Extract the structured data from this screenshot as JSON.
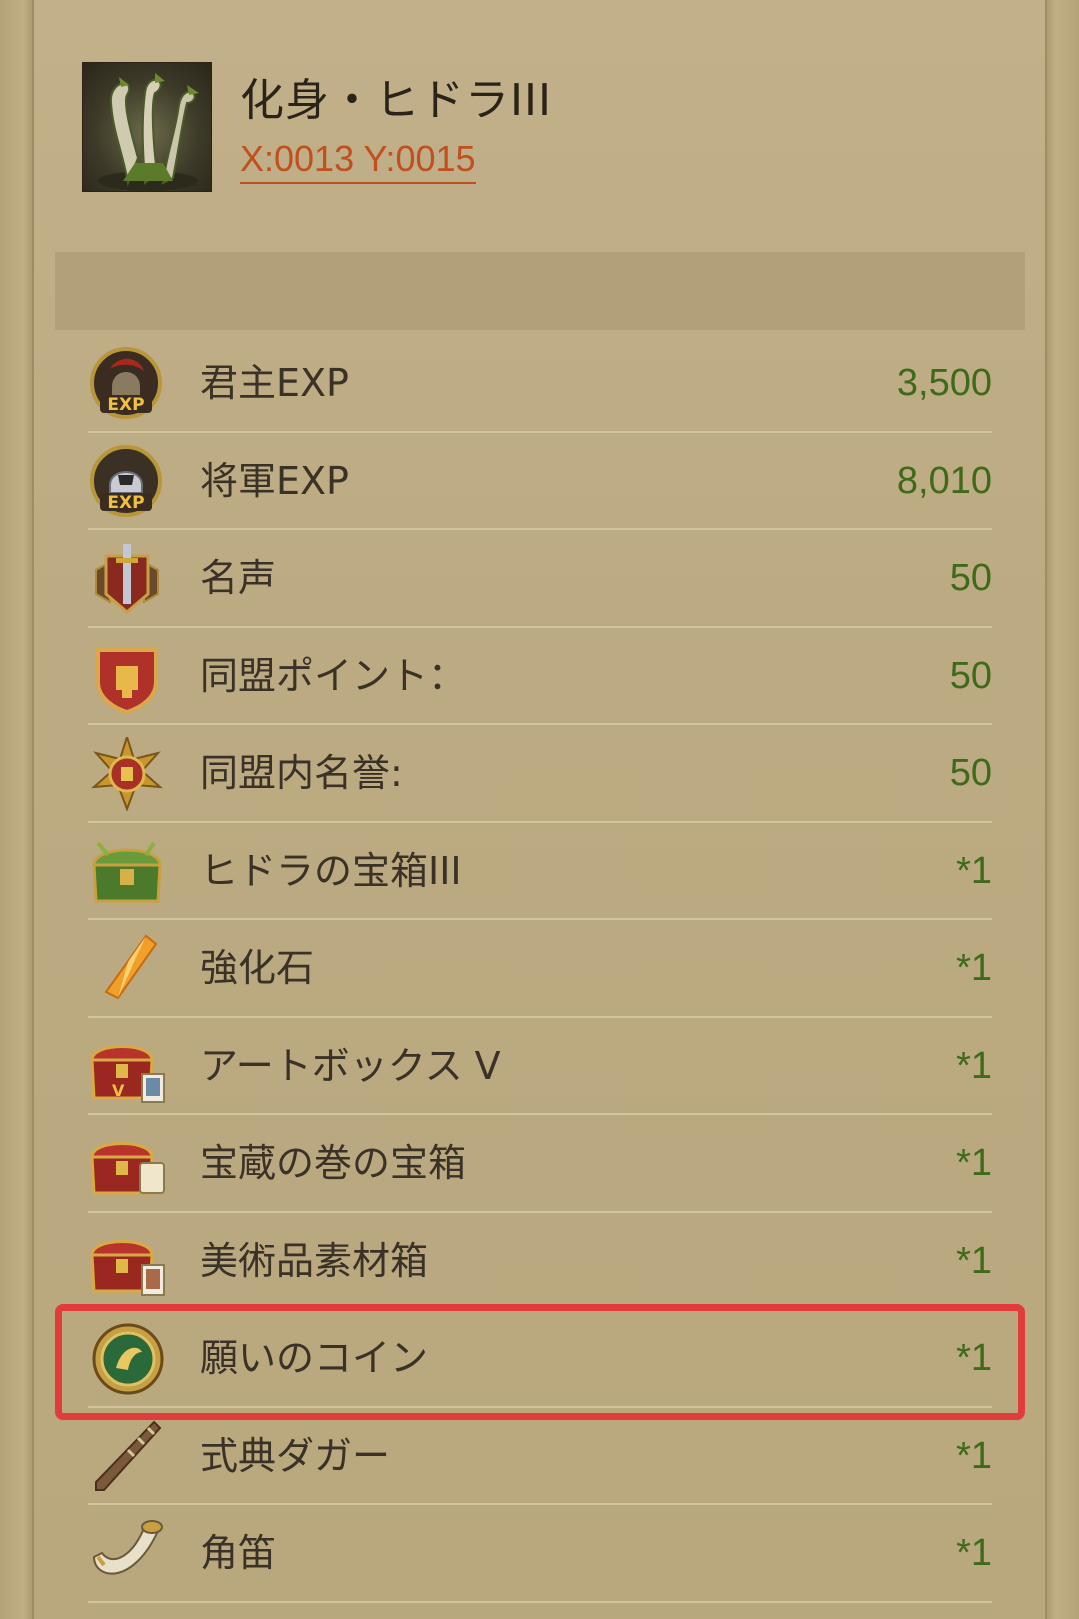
{
  "header": {
    "title": "化身・ヒドラIII",
    "coordinates": "X:0013 Y:0015"
  },
  "rewards": [
    {
      "label": "君主EXP",
      "value": "3,500",
      "icon": "lord-exp-icon"
    },
    {
      "label": "将軍EXP",
      "value": "8,010",
      "icon": "general-exp-icon"
    },
    {
      "label": "名声",
      "value": "50",
      "icon": "fame-icon"
    },
    {
      "label": "同盟ポイント：",
      "value": "50",
      "icon": "alliance-points-icon"
    },
    {
      "label": "同盟内名誉:",
      "value": "50",
      "icon": "alliance-honor-icon"
    },
    {
      "label": "ヒドラの宝箱III",
      "value": "*1",
      "icon": "hydra-chest-icon"
    },
    {
      "label": "強化石",
      "value": "*1",
      "icon": "enhancement-stone-icon"
    },
    {
      "label": "アートボックス V",
      "value": "*1",
      "icon": "art-box-icon"
    },
    {
      "label": "宝蔵の巻の宝箱",
      "value": "*1",
      "icon": "treasure-scroll-chest-icon"
    },
    {
      "label": "美術品素材箱",
      "value": "*1",
      "icon": "art-material-box-icon"
    },
    {
      "label": "願いのコイン",
      "value": "*1",
      "icon": "wish-coin-icon"
    },
    {
      "label": "式典ダガー",
      "value": "*1",
      "icon": "ceremonial-dagger-icon"
    },
    {
      "label": "角笛",
      "value": "*1",
      "icon": "horn-icon"
    }
  ],
  "colors": {
    "background": "#bba980",
    "value_green": "#3f6a1a",
    "coords_orange": "#c0501e",
    "highlight_red": "#e23b3b"
  }
}
